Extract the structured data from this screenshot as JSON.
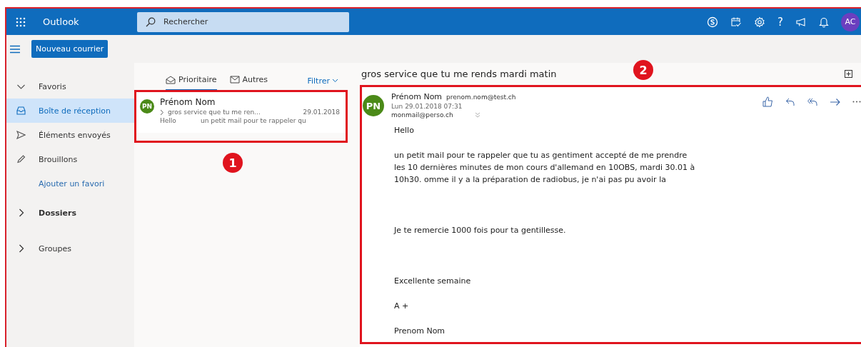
{
  "topbar": {
    "app_name": "Outlook",
    "search": {
      "placeholder": "Rechercher"
    },
    "help": "?",
    "avatar": {
      "initials": "AC",
      "color": "#6b3fbf"
    }
  },
  "toolbar": {
    "new_mail": "Nouveau courrier"
  },
  "sidebar": {
    "favorites": {
      "label": "Favoris",
      "expanded": true,
      "items": [
        {
          "label": "Boîte de réception",
          "selected": true
        },
        {
          "label": "Éléments envoyés",
          "selected": false
        },
        {
          "label": "Brouillons",
          "selected": false
        }
      ],
      "add_link": "Ajouter un favori"
    },
    "sections": [
      {
        "label": "Dossiers",
        "expanded": false,
        "bold": true
      },
      {
        "label": "Groupes",
        "expanded": false,
        "bold": false
      }
    ]
  },
  "message_list": {
    "tabs": [
      {
        "label": "Prioritaire",
        "selected": true
      },
      {
        "label": "Autres",
        "selected": false
      }
    ],
    "filter": "Filtrer",
    "messages": [
      {
        "initials": "PN",
        "color": "#4b8a18",
        "sender": "Prénom Nom",
        "subject": "gros service que tu me ren...",
        "date": "29.01.2018",
        "preview_start": "Hello",
        "preview": "un petit mail pour te rappeler qu",
        "selected": false
      }
    ]
  },
  "reading_pane": {
    "subject": "gros service que tu me rends mardi matin",
    "message": {
      "initials": "PN",
      "color": "#4b8a18",
      "sender": "Prénom Nom",
      "sender_email": "prenom.nom@test.ch",
      "date": "Lun 29.01.2018 07:31",
      "to": "monmail@perso.ch",
      "body": [
        {
          "lines": [
            "Hello"
          ]
        },
        {
          "lines": [
            "un petit mail pour te rappeler que tu as gentiment accepté de me prendre",
            "les 10 dernières minutes de mon cours d'allemand en 10OBS, mardi 30.01 à",
            "10h30.   omme il y a la préparation de radiobus, je n'ai pas pu avoir la"
          ]
        },
        {
          "lines": [
            "Je te remercie 1000 fois pour ta gentillesse."
          ]
        },
        {
          "lines": [
            "Excellente semaine"
          ]
        },
        {
          "lines": [
            "A +"
          ]
        },
        {
          "lines": [
            "Prenom Nom"
          ]
        }
      ]
    }
  },
  "annotations": [
    {
      "number": "1"
    },
    {
      "number": "2"
    }
  ]
}
